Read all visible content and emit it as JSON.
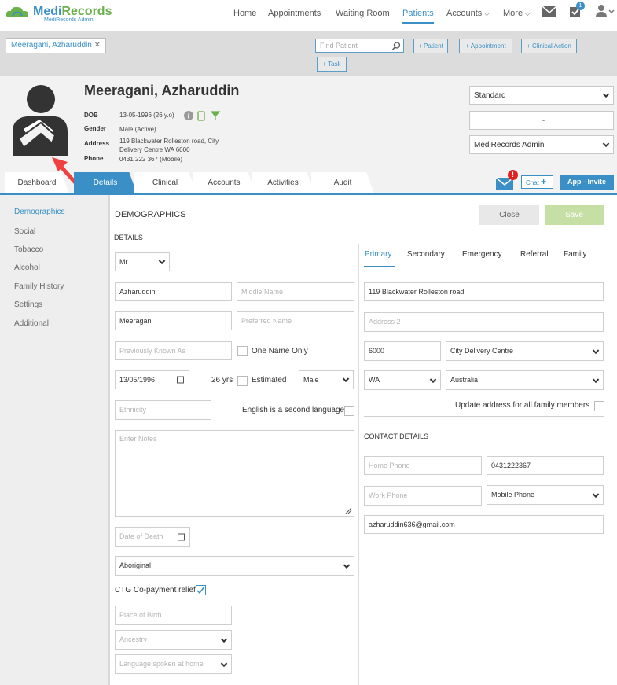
{
  "app": {
    "name_part1": "Medi",
    "name_part2": "Records",
    "subtitle": "MediRecords Admin"
  },
  "nav": {
    "items": [
      "Home",
      "Appointments",
      "Waiting Room",
      "Patients",
      "Accounts",
      "More"
    ],
    "active": "Patients",
    "notification_count": "1"
  },
  "toolbar": {
    "patient_tab": "Meeragani, Azharuddin",
    "find_placeholder": "Find Patient",
    "btn_patient": "+ Patient",
    "btn_appointment": "+ Appointment",
    "btn_clinical_action": "+ Clinical Action",
    "btn_task": "+ Task"
  },
  "patient": {
    "name": "Meeragani, Azharuddin",
    "dob_label": "DOB",
    "dob": "13-05-1996 (26 y.o)",
    "gender_label": "Gender",
    "gender": "Male (Active)",
    "address_label": "Address",
    "address_line1": "119 Blackwater Rolleston road, City",
    "address_line2": "Delivery Centre WA 6000",
    "phone_label": "Phone",
    "phone": "0431 222 367 (Mobile)"
  },
  "right_panel": {
    "billing_type": "Standard",
    "middle_value": "-",
    "practitioner": "MediRecords Admin"
  },
  "tabs": [
    "Dashboard",
    "Details",
    "Clinical",
    "Accounts",
    "Activities",
    "Audit"
  ],
  "active_tab": "Details",
  "chat_label": "Chat",
  "app_invite_label": "App - Invite",
  "sidebar": {
    "items": [
      "Demographics",
      "Social",
      "Tobacco",
      "Alcohol",
      "Family History",
      "Settings",
      "Additional"
    ],
    "active": "Demographics"
  },
  "demographics": {
    "title": "DEMOGRAPHICS",
    "close_label": "Close",
    "save_label": "Save",
    "details_label": "DETAILS",
    "title_value": "Mr",
    "first_name": "Azharuddin",
    "middle_name_ph": "Middle Name",
    "last_name": "Meeragani",
    "preferred_name_ph": "Preferred Name",
    "prev_known_ph": "Previously Known As",
    "one_name_only": "One Name Only",
    "dob_value": "13/05/1996",
    "age": "26 yrs",
    "estimated": "Estimated",
    "sex": "Male",
    "ethnicity_ph": "Ethnicity",
    "english_second": "English is a second language",
    "notes_ph": "Enter Notes",
    "date_of_death_ph": "Date of Death",
    "indigenous_status": "Aboriginal",
    "ctg_label": "CTG Co-payment relief",
    "place_of_birth_ph": "Place of Birth",
    "ancestry_ph": "Ancestry",
    "language_ph": "Language spoken at home"
  },
  "address": {
    "tabs": [
      "Primary",
      "Secondary",
      "Emergency",
      "Referral",
      "Family"
    ],
    "active_tab": "Primary",
    "line1": "119 Blackwater Rolleston road",
    "line2_ph": "Address 2",
    "postcode": "6000",
    "suburb": "City Delivery Centre",
    "state": "WA",
    "country": "Australia",
    "update_all": "Update address for all family members"
  },
  "contact": {
    "title": "CONTACT DETAILS",
    "home_phone_ph": "Home Phone",
    "mobile": "0431222367",
    "work_phone_ph": "Work Phone",
    "phone_type": "Mobile Phone",
    "email": "azharuddin636@gmail.com"
  },
  "colors": {
    "accent": "#3a8fc6",
    "logo_green": "#6ab04c",
    "save_green": "#c5dfa4",
    "alert_red": "#e02020",
    "arrow_red": "#f04040"
  }
}
